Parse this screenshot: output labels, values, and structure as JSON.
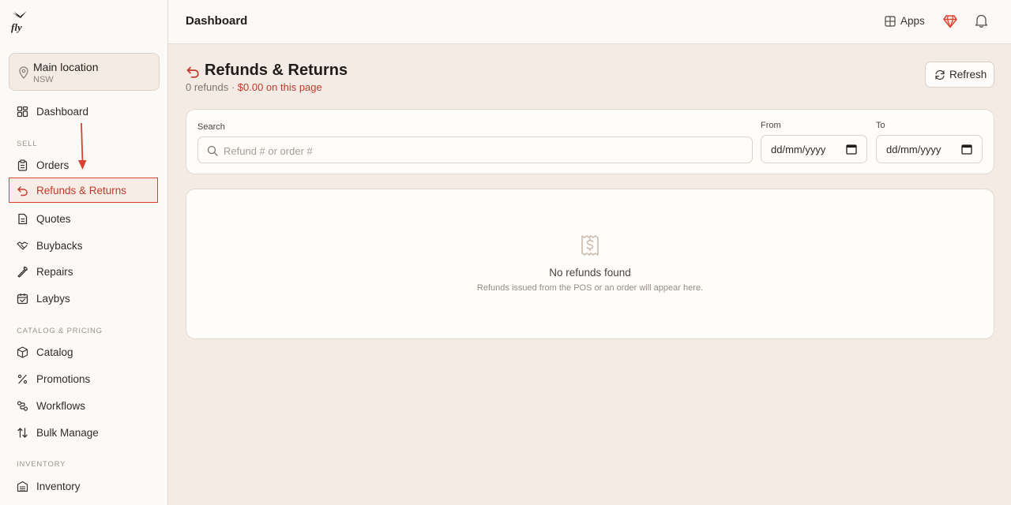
{
  "brand": {
    "logo_text": "fly"
  },
  "location": {
    "name": "Main location",
    "region": "NSW"
  },
  "sidebar": {
    "dashboard": {
      "label": "Dashboard",
      "icon": "dashboard-icon"
    },
    "sections": [
      {
        "label": "SELL",
        "items": [
          {
            "label": "Orders",
            "icon": "clipboard-icon"
          },
          {
            "label": "Refunds & Returns",
            "icon": "undo-icon",
            "active": true
          },
          {
            "label": "Quotes",
            "icon": "document-icon"
          },
          {
            "label": "Buybacks",
            "icon": "handshake-icon"
          },
          {
            "label": "Repairs",
            "icon": "wrench-icon"
          },
          {
            "label": "Laybys",
            "icon": "calendar-check-icon"
          }
        ]
      },
      {
        "label": "CATALOG & PRICING",
        "items": [
          {
            "label": "Catalog",
            "icon": "box-icon"
          },
          {
            "label": "Promotions",
            "icon": "percent-icon"
          },
          {
            "label": "Workflows",
            "icon": "workflow-icon"
          },
          {
            "label": "Bulk Manage",
            "icon": "sort-arrows-icon"
          }
        ]
      },
      {
        "label": "INVENTORY",
        "items": [
          {
            "label": "Inventory",
            "icon": "warehouse-icon"
          }
        ]
      }
    ]
  },
  "topbar": {
    "title": "Dashboard",
    "apps_label": "Apps"
  },
  "page": {
    "title": "Refunds & Returns",
    "subtitle_count": "0 refunds · ",
    "subtitle_amount": "$0.00 on this page",
    "refresh_label": "Refresh"
  },
  "filters": {
    "search_label": "Search",
    "search_placeholder": "Refund # or order #",
    "from_label": "From",
    "from_value": "dd/mm/yyyy",
    "to_label": "To",
    "to_value": "dd/mm/yyyy"
  },
  "empty_state": {
    "title": "No refunds found",
    "message": "Refunds issued from the POS or an order will appear here."
  },
  "colors": {
    "accent": "#c0392b",
    "highlight_border": "#d9432e",
    "background": "#f4ece4"
  }
}
